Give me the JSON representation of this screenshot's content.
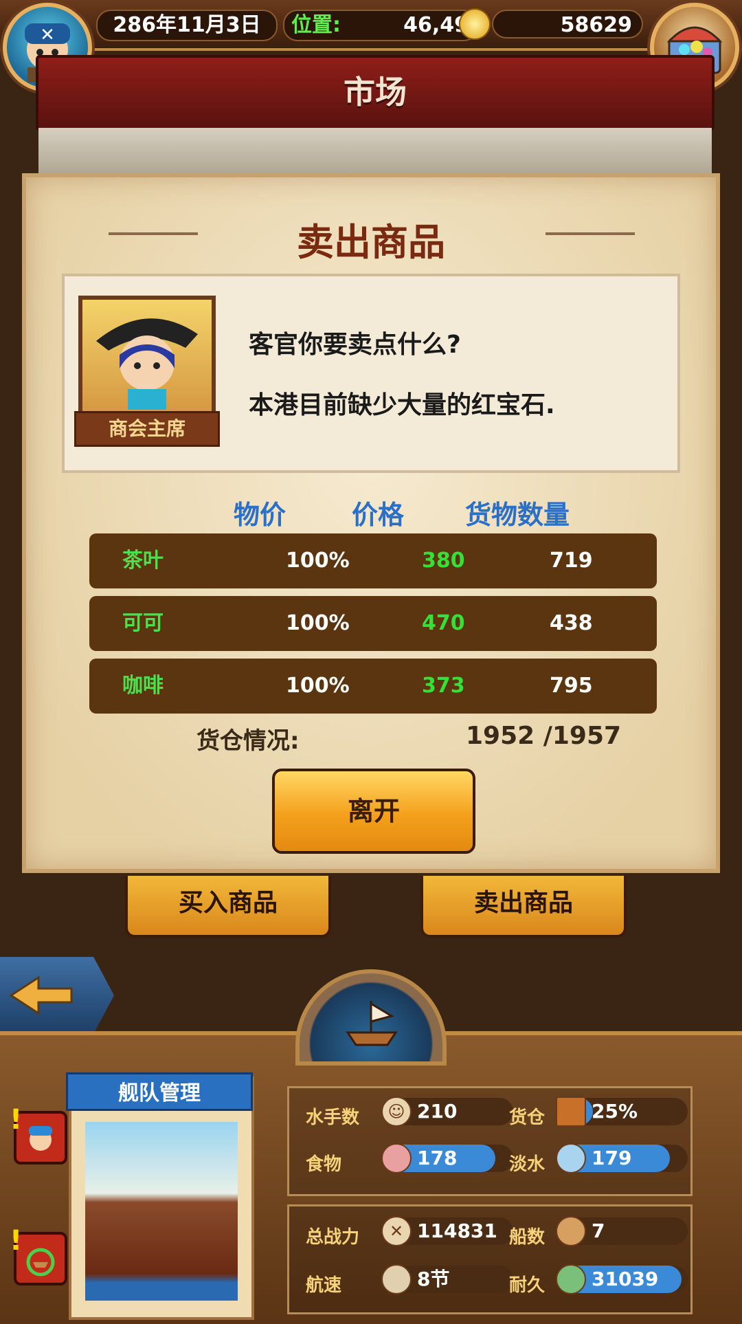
{
  "top_bar": {
    "date": "286年11月3日",
    "position_label": "位置:",
    "position_value": "46,49",
    "gold": "58629"
  },
  "page_title": "市场",
  "dialog": {
    "title": "卖出商品",
    "npc_label": "商会主席",
    "lines": [
      "客官你要卖点什么?",
      "本港目前缺少大量的红宝石."
    ],
    "columns": [
      "物价",
      "价格",
      "货物数量"
    ],
    "goods": [
      {
        "name": "茶叶",
        "price_index": "100%",
        "price": "380",
        "quantity": "719"
      },
      {
        "name": "可可",
        "price_index": "100%",
        "price": "470",
        "quantity": "438"
      },
      {
        "name": "咖啡",
        "price_index": "100%",
        "price": "373",
        "quantity": "795"
      }
    ],
    "hold_label": "货仓情况:",
    "hold_value": "1952 /1957",
    "leave_label": "离开"
  },
  "market_buttons": {
    "buy": "买入商品",
    "sell": "卖出商品"
  },
  "fleet": {
    "title": "舰队管理",
    "stats": [
      {
        "label": "水手数",
        "value": "210",
        "icon": "sailor-icon",
        "fill": 0.18
      },
      {
        "label": "货仓",
        "value": "25%",
        "icon": "crate-icon",
        "fill": 0.25
      },
      {
        "label": "食物",
        "value": "178",
        "icon": "meat-icon",
        "fill": 0.86
      },
      {
        "label": "淡水",
        "value": "179",
        "icon": "water-jug-icon",
        "fill": 0.86
      },
      {
        "label": "总战力",
        "value": "114831",
        "icon": "crossed-swords-icon",
        "fill": 0
      },
      {
        "label": "船数",
        "value": "7",
        "icon": "boat-icon",
        "fill": 0
      },
      {
        "label": "航速",
        "value": "8节",
        "icon": "sail-icon",
        "fill": 0
      },
      {
        "label": "耐久",
        "value": "31039",
        "icon": "ship-repair-icon",
        "fill": 0.95
      }
    ]
  },
  "colors": {
    "goods_name": "#4de04d",
    "price": "#36e036",
    "column_head": "#2a6fc8"
  }
}
